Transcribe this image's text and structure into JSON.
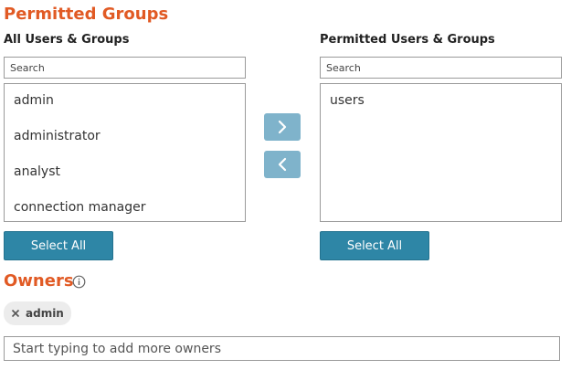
{
  "permitted_groups": {
    "title": "Permitted Groups",
    "left": {
      "title": "All Users & Groups",
      "search_placeholder": "Search",
      "items": [
        "admin",
        "administrator",
        "analyst",
        "connection manager"
      ],
      "select_all_label": "Select All"
    },
    "right": {
      "title": "Permitted Users & Groups",
      "search_placeholder": "Search",
      "items": [
        "users"
      ],
      "select_all_label": "Select All"
    },
    "move_right_icon": "chevron-right-icon",
    "move_left_icon": "chevron-left-icon"
  },
  "owners": {
    "title": "Owners",
    "info_icon": "info-icon",
    "chips": [
      {
        "label": "admin",
        "remove_icon": "close-icon"
      }
    ],
    "input_placeholder": "Start typing to add more owners"
  },
  "colors": {
    "accent": "#e15a24",
    "button": "#2e86a6",
    "arrow_button": "#7fb3cb"
  }
}
